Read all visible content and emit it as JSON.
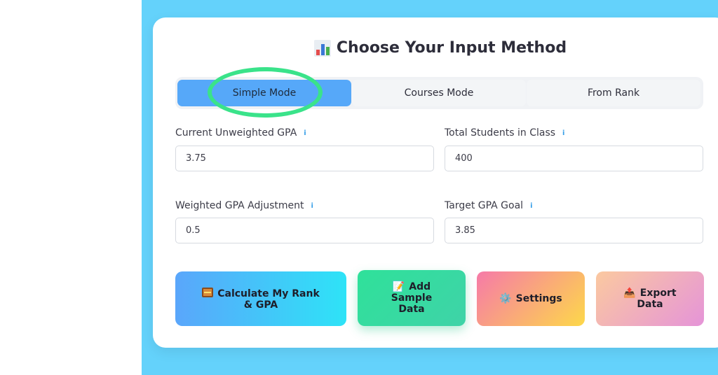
{
  "title": {
    "icon": "bar-chart-icon",
    "text": "Choose Your Input Method"
  },
  "tabs": [
    {
      "label": "Simple Mode",
      "active": true
    },
    {
      "label": "Courses Mode",
      "active": false
    },
    {
      "label": "From Rank",
      "active": false
    }
  ],
  "fields": {
    "current_gpa": {
      "label": "Current Unweighted GPA",
      "value": "3.75"
    },
    "total_students": {
      "label": "Total Students in Class",
      "value": "400"
    },
    "weighted_adjustment": {
      "label": "Weighted GPA Adjustment",
      "value": "0.5"
    },
    "target_gpa": {
      "label": "Target GPA Goal",
      "value": "3.85"
    }
  },
  "info_glyph": "i",
  "buttons": {
    "calculate": {
      "icon": "abacus-icon",
      "line1": "Calculate My Rank",
      "line2": "& GPA"
    },
    "sample": {
      "icon": "memo-icon",
      "glyph": "📝",
      "line1": "Add",
      "line2": "Sample",
      "line3": "Data"
    },
    "settings": {
      "icon": "gear-icon",
      "glyph": "⚙️",
      "label": "Settings"
    },
    "export": {
      "icon": "outbox-tray-icon",
      "glyph": "📤",
      "line1": "Export",
      "line2": "Data"
    }
  },
  "colors": {
    "background": "#64d2fb",
    "active_tab": "#56a8f9",
    "highlight_ring": "#3ae38a",
    "info_icon": "#3aa0e8"
  }
}
